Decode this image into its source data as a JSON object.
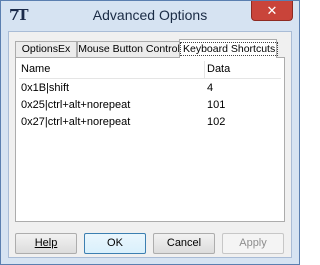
{
  "window": {
    "title": "Advanced Options",
    "icon": "7T-app-icon",
    "close_label": "✕"
  },
  "tabs": [
    {
      "label": "OptionsEx",
      "active": false
    },
    {
      "label": "Mouse Button Control",
      "active": false
    },
    {
      "label": "Keyboard Shortcuts",
      "active": true
    }
  ],
  "list": {
    "columns": [
      "Name",
      "Data"
    ],
    "rows": [
      {
        "name": "0x1B|shift",
        "data": "4"
      },
      {
        "name": "0x25|ctrl+alt+norepeat",
        "data": "101"
      },
      {
        "name": "0x27|ctrl+alt+norepeat",
        "data": "102"
      }
    ]
  },
  "buttons": {
    "help": "Help",
    "ok": "OK",
    "cancel": "Cancel",
    "apply": "Apply"
  }
}
